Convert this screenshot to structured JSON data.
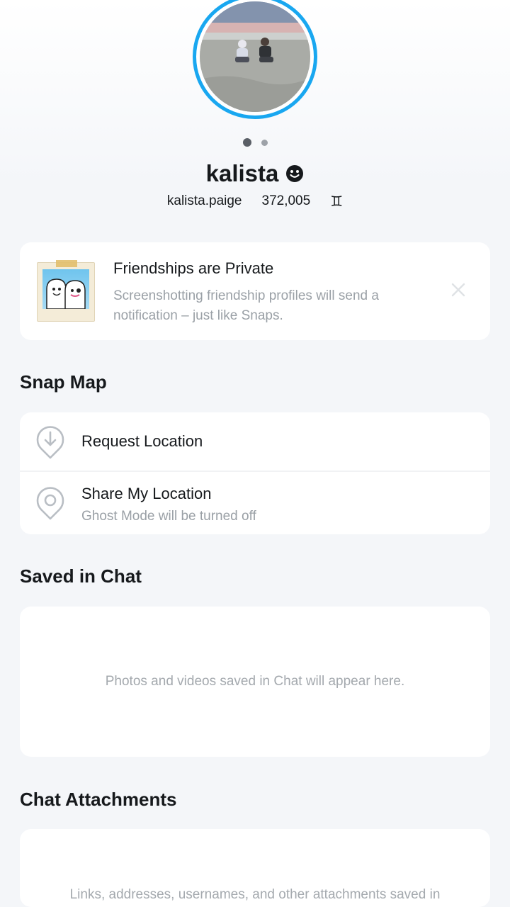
{
  "profile": {
    "display_name": "kalista",
    "username": "kalista.paige",
    "score": "372,005",
    "zodiac_symbol": "♊",
    "accent_color": "#19a7f0"
  },
  "privacy_notice": {
    "title": "Friendships are Private",
    "description": "Screenshotting friendship profiles will send a notification – just like Snaps."
  },
  "snap_map": {
    "section_title": "Snap Map",
    "request_location": "Request Location",
    "share_location": "Share My Location",
    "share_location_sub": "Ghost Mode will be turned off"
  },
  "saved_in_chat": {
    "section_title": "Saved in Chat",
    "empty_text": "Photos and videos saved in Chat will appear here."
  },
  "chat_attachments": {
    "section_title": "Chat Attachments",
    "empty_text": "Links, addresses, usernames, and other attachments saved in"
  }
}
